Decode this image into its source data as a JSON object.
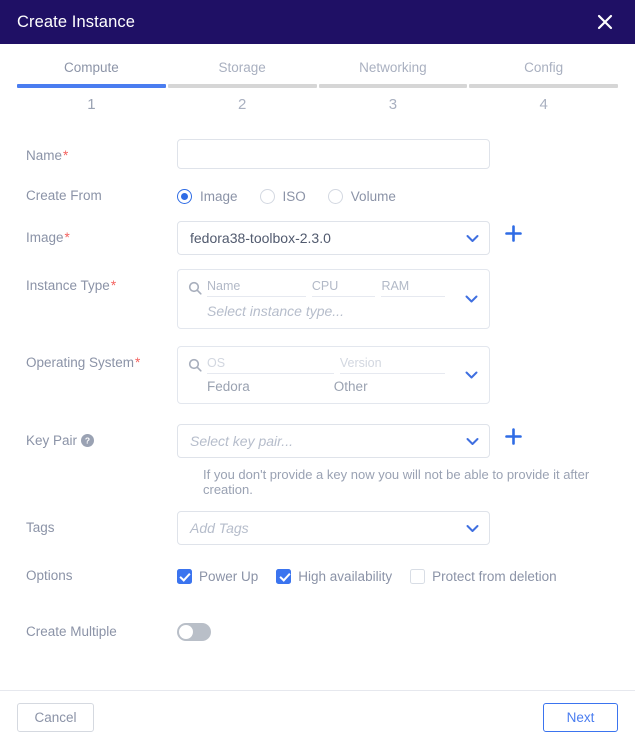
{
  "dialog": {
    "title": "Create Instance",
    "close_icon": "close-icon"
  },
  "stepper": {
    "steps": [
      {
        "label": "Compute",
        "number": "1",
        "active": true
      },
      {
        "label": "Storage",
        "number": "2",
        "active": false
      },
      {
        "label": "Networking",
        "number": "3",
        "active": false
      },
      {
        "label": "Config",
        "number": "4",
        "active": false
      }
    ]
  },
  "form": {
    "name": {
      "label": "Name",
      "required": "*",
      "value": "",
      "placeholder": ""
    },
    "create_from": {
      "label": "Create From",
      "options": [
        {
          "label": "Image",
          "checked": true
        },
        {
          "label": "ISO",
          "checked": false
        },
        {
          "label": "Volume",
          "checked": false
        }
      ]
    },
    "image": {
      "label": "Image",
      "required": "*",
      "value": "fedora38-toolbox-2.3.0",
      "add_icon": "plus-icon",
      "caret_icon": "chevron-down-icon"
    },
    "instance_type": {
      "label": "Instance Type",
      "required": "*",
      "columns": [
        "Name",
        "CPU",
        "RAM"
      ],
      "empty_text": "Select instance type...",
      "search_icon": "search-icon",
      "caret_icon": "chevron-down-icon"
    },
    "operating_system": {
      "label": "Operating System",
      "required": "*",
      "columns": [
        "OS",
        "Version"
      ],
      "values": [
        "Fedora",
        "Other"
      ],
      "search_icon": "search-icon",
      "caret_icon": "chevron-down-icon"
    },
    "key_pair": {
      "label": "Key Pair",
      "help_icon": "help-circle-icon",
      "placeholder": "Select key pair...",
      "add_icon": "plus-icon",
      "caret_icon": "chevron-down-icon",
      "hint": "If you don't provide a key now you will not be able to provide it after creation."
    },
    "tags": {
      "label": "Tags",
      "placeholder": "Add Tags",
      "caret_icon": "chevron-down-icon"
    },
    "options": {
      "label": "Options",
      "items": [
        {
          "label": "Power Up",
          "checked": true
        },
        {
          "label": "High availability",
          "checked": true
        },
        {
          "label": "Protect from deletion",
          "checked": false
        }
      ]
    },
    "create_multiple": {
      "label": "Create Multiple",
      "enabled": false
    }
  },
  "footer": {
    "cancel_label": "Cancel",
    "next_label": "Next"
  },
  "colors": {
    "titlebar": "#1f1065",
    "accent": "#3b74ef",
    "active_step": "#4a7df0",
    "required": "#f4625f",
    "label_text": "#8b93a7",
    "inactive_bar": "#d6d6d6"
  }
}
